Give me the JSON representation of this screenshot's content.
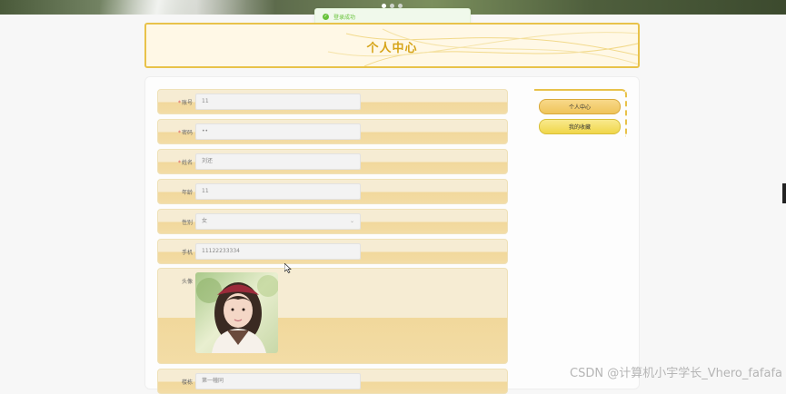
{
  "toast": {
    "text": "登录成功",
    "icon": "success-check-icon"
  },
  "page": {
    "title": "个人中心"
  },
  "form": {
    "account": {
      "label": "账号",
      "required": true,
      "value": "11"
    },
    "password": {
      "label": "密码",
      "required": true,
      "value": "••"
    },
    "name": {
      "label": "姓名",
      "required": true,
      "value": "刘还"
    },
    "age": {
      "label": "年龄",
      "required": false,
      "value": "11"
    },
    "gender": {
      "label": "性别",
      "required": false,
      "value": "女"
    },
    "phone": {
      "label": "手机",
      "required": false,
      "value": "11122233334"
    },
    "avatar": {
      "label": "头像"
    },
    "building": {
      "label": "楼栋",
      "required": false,
      "value": "第一幢同"
    }
  },
  "side_nav": {
    "items": [
      {
        "label": "个人中心"
      },
      {
        "label": "我的收藏"
      }
    ]
  },
  "watermark": "CSDN @计算机小宇学长_Vhero_fafafa",
  "colors": {
    "accent": "#e8c24a",
    "title": "#d6a418",
    "success": "#67c23a"
  }
}
